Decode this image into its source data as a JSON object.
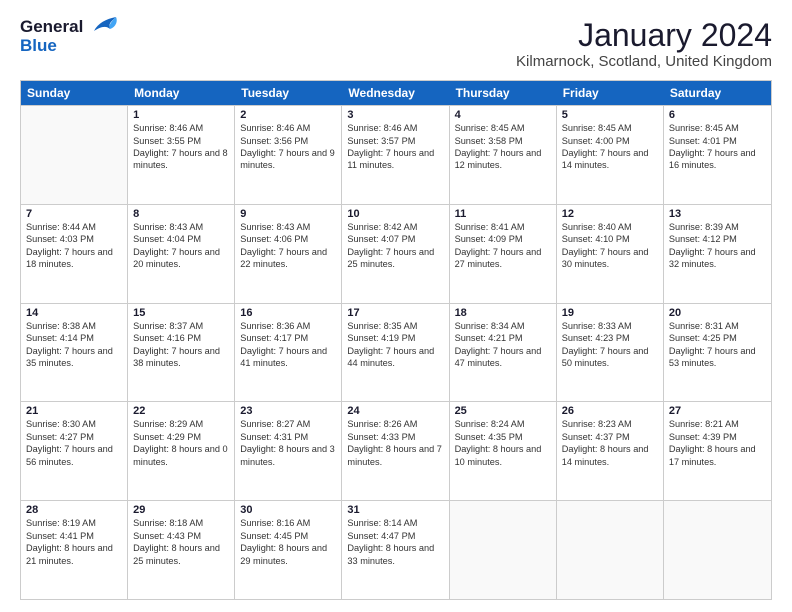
{
  "header": {
    "logo_line1": "General",
    "logo_line2": "Blue",
    "month_title": "January 2024",
    "location": "Kilmarnock, Scotland, United Kingdom"
  },
  "days": [
    "Sunday",
    "Monday",
    "Tuesday",
    "Wednesday",
    "Thursday",
    "Friday",
    "Saturday"
  ],
  "weeks": [
    [
      {
        "day": "",
        "sunrise": "",
        "sunset": "",
        "daylight": "",
        "empty": true
      },
      {
        "day": "1",
        "sunrise": "Sunrise: 8:46 AM",
        "sunset": "Sunset: 3:55 PM",
        "daylight": "Daylight: 7 hours and 8 minutes."
      },
      {
        "day": "2",
        "sunrise": "Sunrise: 8:46 AM",
        "sunset": "Sunset: 3:56 PM",
        "daylight": "Daylight: 7 hours and 9 minutes."
      },
      {
        "day": "3",
        "sunrise": "Sunrise: 8:46 AM",
        "sunset": "Sunset: 3:57 PM",
        "daylight": "Daylight: 7 hours and 11 minutes."
      },
      {
        "day": "4",
        "sunrise": "Sunrise: 8:45 AM",
        "sunset": "Sunset: 3:58 PM",
        "daylight": "Daylight: 7 hours and 12 minutes."
      },
      {
        "day": "5",
        "sunrise": "Sunrise: 8:45 AM",
        "sunset": "Sunset: 4:00 PM",
        "daylight": "Daylight: 7 hours and 14 minutes."
      },
      {
        "day": "6",
        "sunrise": "Sunrise: 8:45 AM",
        "sunset": "Sunset: 4:01 PM",
        "daylight": "Daylight: 7 hours and 16 minutes."
      }
    ],
    [
      {
        "day": "7",
        "sunrise": "Sunrise: 8:44 AM",
        "sunset": "Sunset: 4:03 PM",
        "daylight": "Daylight: 7 hours and 18 minutes."
      },
      {
        "day": "8",
        "sunrise": "Sunrise: 8:43 AM",
        "sunset": "Sunset: 4:04 PM",
        "daylight": "Daylight: 7 hours and 20 minutes."
      },
      {
        "day": "9",
        "sunrise": "Sunrise: 8:43 AM",
        "sunset": "Sunset: 4:06 PM",
        "daylight": "Daylight: 7 hours and 22 minutes."
      },
      {
        "day": "10",
        "sunrise": "Sunrise: 8:42 AM",
        "sunset": "Sunset: 4:07 PM",
        "daylight": "Daylight: 7 hours and 25 minutes."
      },
      {
        "day": "11",
        "sunrise": "Sunrise: 8:41 AM",
        "sunset": "Sunset: 4:09 PM",
        "daylight": "Daylight: 7 hours and 27 minutes."
      },
      {
        "day": "12",
        "sunrise": "Sunrise: 8:40 AM",
        "sunset": "Sunset: 4:10 PM",
        "daylight": "Daylight: 7 hours and 30 minutes."
      },
      {
        "day": "13",
        "sunrise": "Sunrise: 8:39 AM",
        "sunset": "Sunset: 4:12 PM",
        "daylight": "Daylight: 7 hours and 32 minutes."
      }
    ],
    [
      {
        "day": "14",
        "sunrise": "Sunrise: 8:38 AM",
        "sunset": "Sunset: 4:14 PM",
        "daylight": "Daylight: 7 hours and 35 minutes."
      },
      {
        "day": "15",
        "sunrise": "Sunrise: 8:37 AM",
        "sunset": "Sunset: 4:16 PM",
        "daylight": "Daylight: 7 hours and 38 minutes."
      },
      {
        "day": "16",
        "sunrise": "Sunrise: 8:36 AM",
        "sunset": "Sunset: 4:17 PM",
        "daylight": "Daylight: 7 hours and 41 minutes."
      },
      {
        "day": "17",
        "sunrise": "Sunrise: 8:35 AM",
        "sunset": "Sunset: 4:19 PM",
        "daylight": "Daylight: 7 hours and 44 minutes."
      },
      {
        "day": "18",
        "sunrise": "Sunrise: 8:34 AM",
        "sunset": "Sunset: 4:21 PM",
        "daylight": "Daylight: 7 hours and 47 minutes."
      },
      {
        "day": "19",
        "sunrise": "Sunrise: 8:33 AM",
        "sunset": "Sunset: 4:23 PM",
        "daylight": "Daylight: 7 hours and 50 minutes."
      },
      {
        "day": "20",
        "sunrise": "Sunrise: 8:31 AM",
        "sunset": "Sunset: 4:25 PM",
        "daylight": "Daylight: 7 hours and 53 minutes."
      }
    ],
    [
      {
        "day": "21",
        "sunrise": "Sunrise: 8:30 AM",
        "sunset": "Sunset: 4:27 PM",
        "daylight": "Daylight: 7 hours and 56 minutes."
      },
      {
        "day": "22",
        "sunrise": "Sunrise: 8:29 AM",
        "sunset": "Sunset: 4:29 PM",
        "daylight": "Daylight: 8 hours and 0 minutes."
      },
      {
        "day": "23",
        "sunrise": "Sunrise: 8:27 AM",
        "sunset": "Sunset: 4:31 PM",
        "daylight": "Daylight: 8 hours and 3 minutes."
      },
      {
        "day": "24",
        "sunrise": "Sunrise: 8:26 AM",
        "sunset": "Sunset: 4:33 PM",
        "daylight": "Daylight: 8 hours and 7 minutes."
      },
      {
        "day": "25",
        "sunrise": "Sunrise: 8:24 AM",
        "sunset": "Sunset: 4:35 PM",
        "daylight": "Daylight: 8 hours and 10 minutes."
      },
      {
        "day": "26",
        "sunrise": "Sunrise: 8:23 AM",
        "sunset": "Sunset: 4:37 PM",
        "daylight": "Daylight: 8 hours and 14 minutes."
      },
      {
        "day": "27",
        "sunrise": "Sunrise: 8:21 AM",
        "sunset": "Sunset: 4:39 PM",
        "daylight": "Daylight: 8 hours and 17 minutes."
      }
    ],
    [
      {
        "day": "28",
        "sunrise": "Sunrise: 8:19 AM",
        "sunset": "Sunset: 4:41 PM",
        "daylight": "Daylight: 8 hours and 21 minutes."
      },
      {
        "day": "29",
        "sunrise": "Sunrise: 8:18 AM",
        "sunset": "Sunset: 4:43 PM",
        "daylight": "Daylight: 8 hours and 25 minutes."
      },
      {
        "day": "30",
        "sunrise": "Sunrise: 8:16 AM",
        "sunset": "Sunset: 4:45 PM",
        "daylight": "Daylight: 8 hours and 29 minutes."
      },
      {
        "day": "31",
        "sunrise": "Sunrise: 8:14 AM",
        "sunset": "Sunset: 4:47 PM",
        "daylight": "Daylight: 8 hours and 33 minutes."
      },
      {
        "day": "",
        "sunrise": "",
        "sunset": "",
        "daylight": "",
        "empty": true
      },
      {
        "day": "",
        "sunrise": "",
        "sunset": "",
        "daylight": "",
        "empty": true
      },
      {
        "day": "",
        "sunrise": "",
        "sunset": "",
        "daylight": "",
        "empty": true
      }
    ]
  ]
}
